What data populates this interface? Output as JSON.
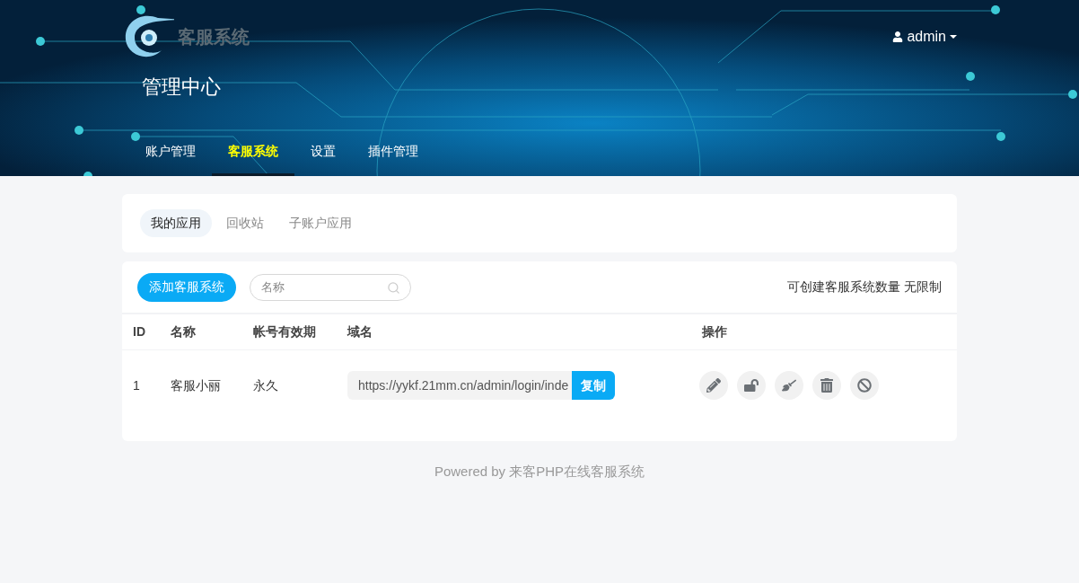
{
  "header": {
    "logo_text": "客服系统",
    "title": "管理中心",
    "user": "admin",
    "nav": [
      {
        "label": "账户管理",
        "selected": false
      },
      {
        "label": "客服系统",
        "selected": true
      },
      {
        "label": "设置",
        "selected": false
      },
      {
        "label": "插件管理",
        "selected": false
      }
    ]
  },
  "subtabs": [
    {
      "label": "我的应用",
      "selected": true
    },
    {
      "label": "回收站",
      "selected": false
    },
    {
      "label": "子账户应用",
      "selected": false
    }
  ],
  "toolbar": {
    "add_button": "添加客服系统",
    "search": {
      "placeholder": "名称"
    },
    "quota": "可创建客服系统数量 无限制"
  },
  "table": {
    "columns": [
      "ID",
      "名称",
      "帐号有效期",
      "域名",
      "操作"
    ],
    "rows": [
      {
        "id": "1",
        "name": "客服小丽",
        "validity": "永久",
        "domain": "https://yykf.21mm.cn/admin/login/inde",
        "copy_button": "复制"
      }
    ]
  },
  "footer": "Powered by 来客PHP在线客服系统"
}
